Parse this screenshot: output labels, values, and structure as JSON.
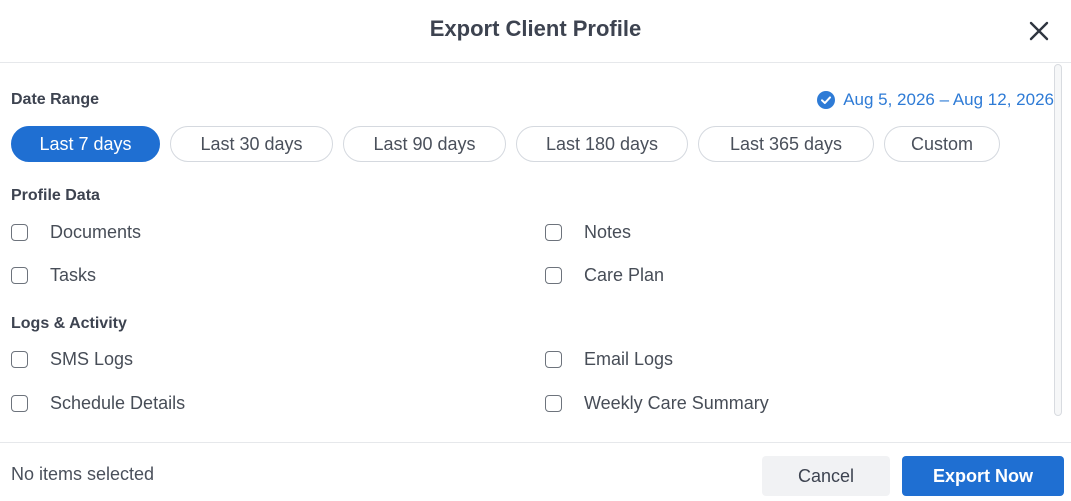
{
  "dialog": {
    "title": "Export Client Profile",
    "close_icon": "close-icon"
  },
  "date_range": {
    "label": "Date Range",
    "selected_range": "Aug 5, 2026 – Aug 12, 2026",
    "check_icon": "check-circle-icon",
    "chips": [
      {
        "label": "Last 7 days",
        "active": true
      },
      {
        "label": "Last 30 days",
        "active": false
      },
      {
        "label": "Last 90 days",
        "active": false
      },
      {
        "label": "Last 180 days",
        "active": false
      },
      {
        "label": "Last 365 days",
        "active": false
      },
      {
        "label": "Custom",
        "active": false
      }
    ]
  },
  "profile_data": {
    "label": "Profile Data",
    "items": [
      {
        "label": "Documents",
        "checked": false
      },
      {
        "label": "Notes",
        "checked": false
      },
      {
        "label": "Tasks",
        "checked": false
      },
      {
        "label": "Care Plan",
        "checked": false
      }
    ]
  },
  "logs_activity": {
    "label": "Logs & Activity",
    "items": [
      {
        "label": "SMS Logs",
        "checked": false
      },
      {
        "label": "Email Logs",
        "checked": false
      },
      {
        "label": "Schedule Details",
        "checked": false
      },
      {
        "label": "Weekly Care Summary",
        "checked": false
      }
    ]
  },
  "footer": {
    "status": "No items selected",
    "cancel_label": "Cancel",
    "export_label": "Export Now"
  },
  "colors": {
    "accent": "#1f6fd2",
    "link": "#2e7bd6"
  }
}
